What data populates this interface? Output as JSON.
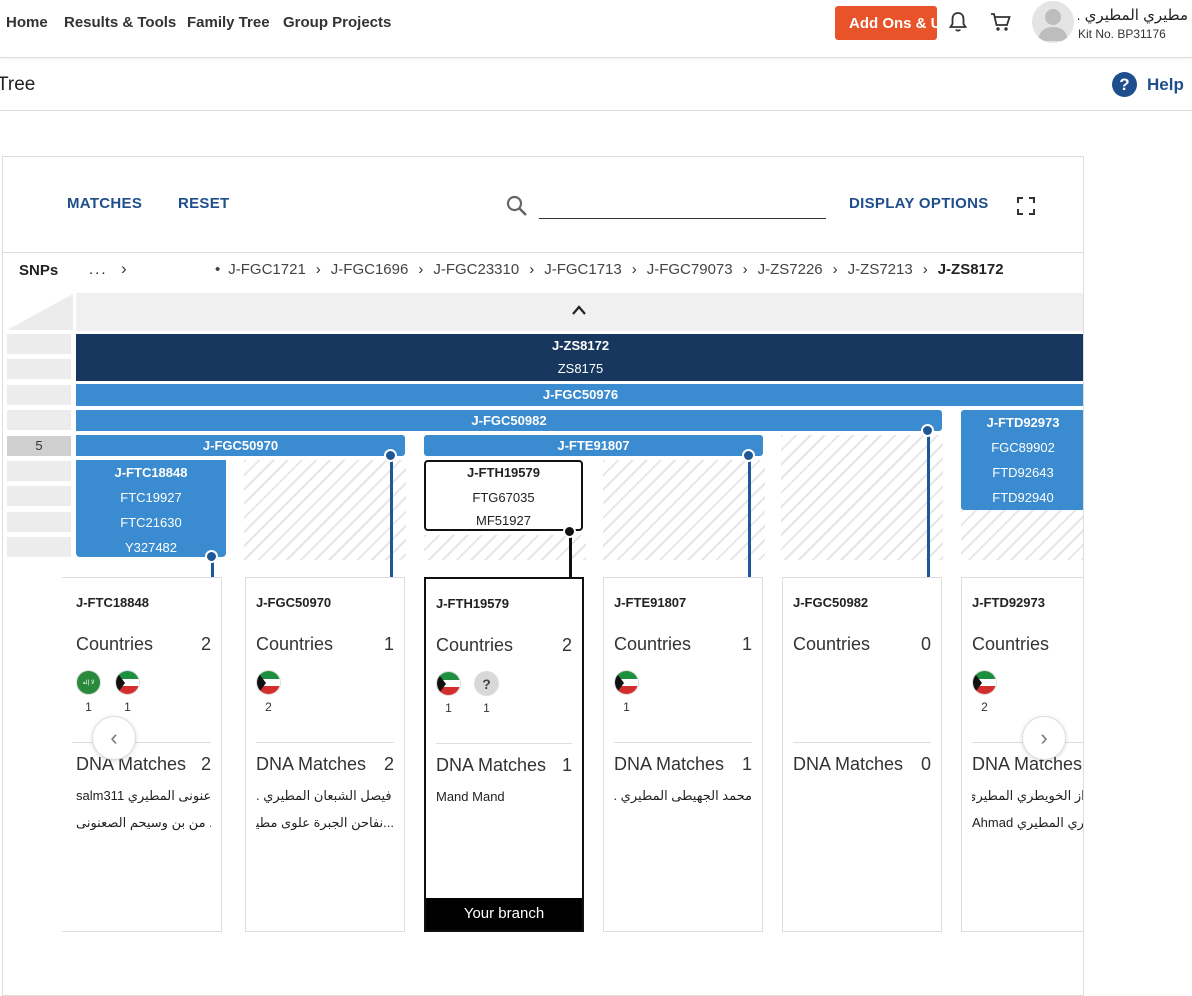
{
  "nav": {
    "items": [
      "Home",
      "Results & Tools",
      "Family Tree",
      "Group Projects"
    ],
    "addons_label": "Add Ons & Upgrades",
    "user_name": "مطيري المطيري .",
    "kit_no": "Kit No. BP31176",
    "icons": [
      "bell-icon",
      "cart-icon",
      "avatar"
    ]
  },
  "page": {
    "title": "Tree",
    "help_label": "Help"
  },
  "toolbar": {
    "matches_label": "MATCHES",
    "reset_label": "RESET",
    "search_placeholder": "",
    "display_options_label": "DISPLAY OPTIONS"
  },
  "snps": {
    "label": "SNPs",
    "ellipsis": "...",
    "crumbs": [
      "J-FGC1721",
      "J-FGC1696",
      "J-FGC23310",
      "J-FGC1713",
      "J-FGC79073",
      "J-ZS7226",
      "J-ZS7213",
      "J-ZS8172"
    ]
  },
  "tree": {
    "level_label": "5",
    "root": {
      "name": "J-ZS8172",
      "sub": "ZS8175"
    },
    "level2": "J-FGC50976",
    "level3": "J-FGC50982",
    "level4a": "J-FGC50970",
    "level4b": "J-FTE91807",
    "ftd": {
      "name": "J-FTD92973",
      "snps": [
        "FGC89902",
        "FTD92643",
        "FTD92940"
      ]
    },
    "ftc": {
      "name": "J-FTC18848",
      "snps": [
        "FTC19927",
        "FTC21630",
        "Y327482"
      ]
    },
    "fth": {
      "name": "J-FTH19579",
      "snps": [
        "FTG67035",
        "MF51927"
      ]
    }
  },
  "cards": [
    {
      "title": "J-FTC18848",
      "countries_label": "Countries",
      "countries": "2",
      "flag_counts": [
        "1",
        "1"
      ],
      "dna_label": "DNA Matches",
      "dna": "2",
      "matches": [
        "salm311 عنونى المطيري",
        "من بن وسيحم الصعنونى ."
      ]
    },
    {
      "title": "J-FGC50970",
      "countries_label": "Countries",
      "countries": "1",
      "flag_counts": [
        "2"
      ],
      "dna_label": "DNA Matches",
      "dna": "2",
      "matches": [
        "فيصل الشبعان المطيري .",
        "...نفاحن الجبرة علوى مطير ."
      ]
    },
    {
      "title": "J-FTH19579",
      "countries_label": "Countries",
      "countries": "2",
      "flag_counts": [
        "1",
        "1"
      ],
      "dna_label": "DNA Matches",
      "dna": "1",
      "matches": [
        "Mand Mand",
        ""
      ],
      "badge": "Your branch"
    },
    {
      "title": "J-FTE91807",
      "countries_label": "Countries",
      "countries": "1",
      "flag_counts": [
        "1"
      ],
      "dna_label": "DNA Matches",
      "dna": "1",
      "matches": [
        "محمد الجهيطى المطيري .",
        ""
      ]
    },
    {
      "title": "J-FGC50982",
      "countries_label": "Countries",
      "countries": "0",
      "flag_counts": [],
      "dna_label": "DNA Matches",
      "dna": "0",
      "matches": [
        "",
        ""
      ]
    },
    {
      "title": "J-FTD92973",
      "countries_label": "Countries",
      "countries": "",
      "flag_counts": [
        "2"
      ],
      "dna_label": "DNA Matches",
      "dna": "",
      "matches": [
        "واز الخويطري المطيري .",
        "Ahmad يطري المطيري"
      ]
    }
  ],
  "colors": {
    "dark_bar": "#17375e",
    "mid_bar": "#3a8bd0",
    "accent": "#e8532a",
    "link": "#1f4e8c"
  }
}
